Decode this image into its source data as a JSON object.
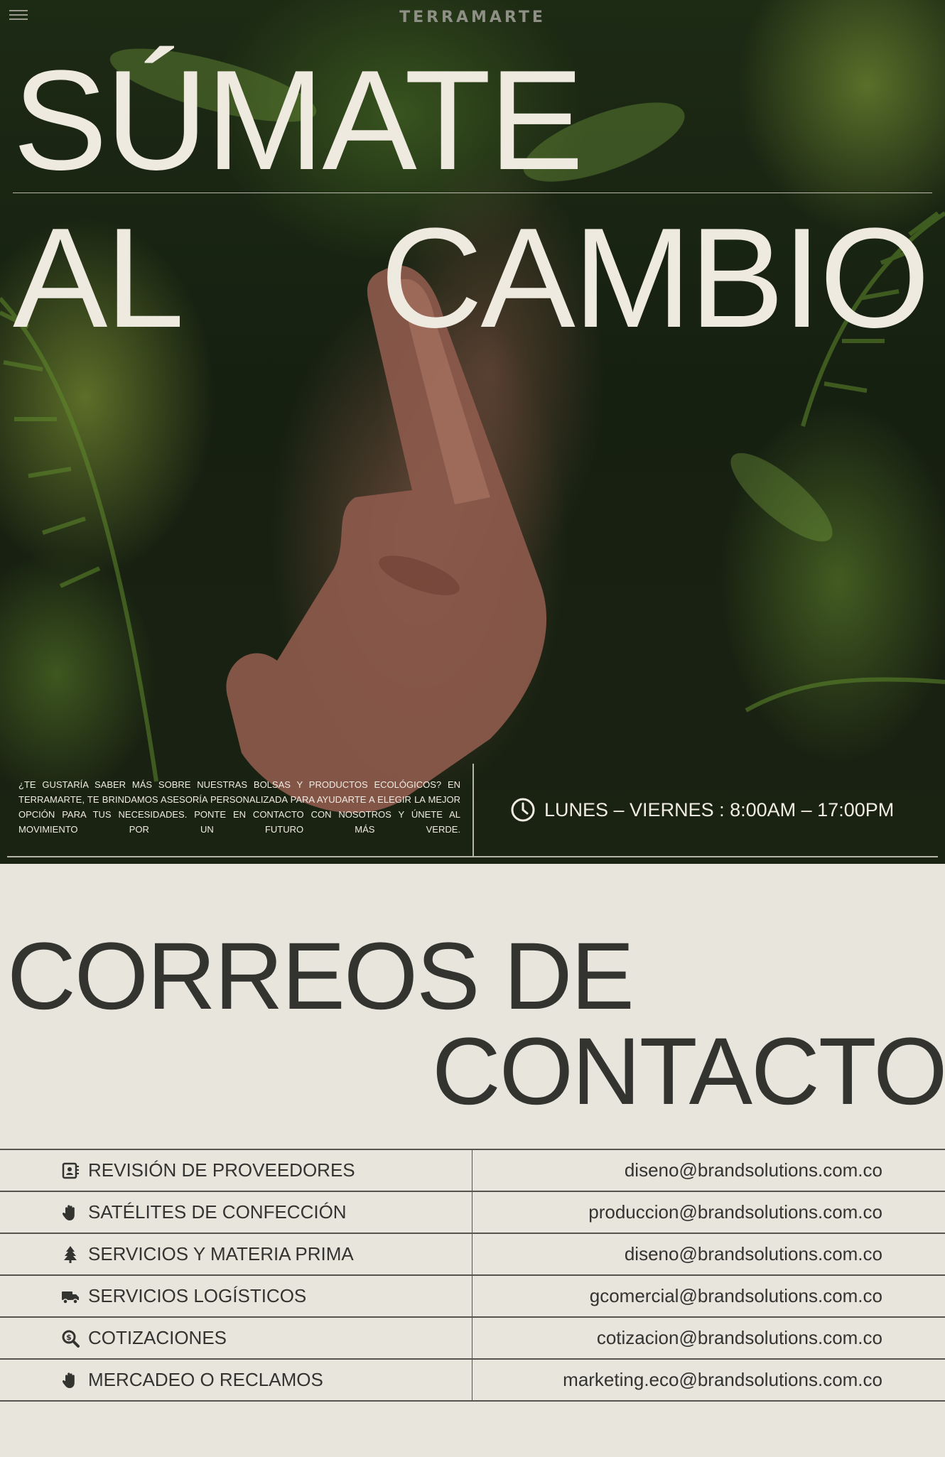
{
  "header": {
    "brand": "TERRAMARTE"
  },
  "hero": {
    "headline_line1": "SÚMATE",
    "headline_al": "AL",
    "headline_cambio": "CAMBIO",
    "blurb": "¿Te gustaría saber más sobre nuestras bolsas y productos ecológicos? En Terramarte, te brindamos asesoría personalizada para ayudarte a elegir la mejor opción para tus necesidades. Ponte en contacto con nosotros y únete al movimiento por un futuro más verde.",
    "hours": "LUNES – VIERNES : 8:00AM – 17:00PM",
    "hours_icon": "clock-icon"
  },
  "contact": {
    "title_line1": "CORREOS DE",
    "title_line2": "CONTACTO",
    "rows": [
      {
        "icon": "contact-card-icon",
        "label": "REVISIÓN DE PROVEEDORES",
        "email": "diseno@brandsolutions.com.co"
      },
      {
        "icon": "hand-icon",
        "label": "SATÉLITES DE CONFECCIÓN",
        "email": "produccion@brandsolutions.com.co"
      },
      {
        "icon": "tree-icon",
        "label": "SERVICIOS Y MATERIA PRIMA",
        "email": "diseno@brandsolutions.com.co"
      },
      {
        "icon": "truck-icon",
        "label": "SERVICIOS LOGÍSTICOS",
        "email": "gcomercial@brandsolutions.com.co"
      },
      {
        "icon": "search-dollar-icon",
        "label": "COTIZACIONES",
        "email": "cotizacion@brandsolutions.com.co"
      },
      {
        "icon": "hand-icon",
        "label": "MERCADEO O RECLAMOS",
        "email": "marketing.eco@brandsolutions.com.co"
      }
    ]
  },
  "colors": {
    "text_light": "#efeadf",
    "text_dark": "#333330",
    "page_bg": "#e8e5dd"
  }
}
